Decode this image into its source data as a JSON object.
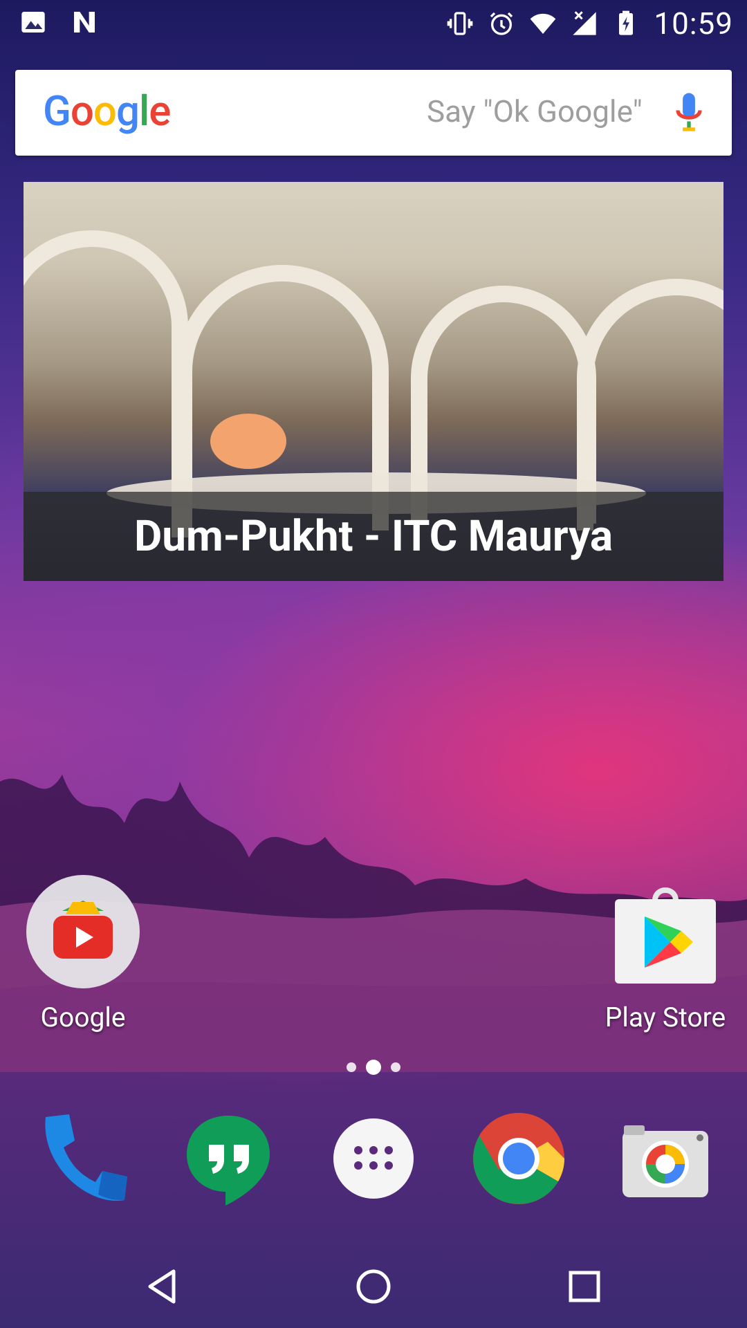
{
  "status_bar": {
    "time": "10:59",
    "left_icons": [
      "gallery-notification-icon",
      "n-notification-icon"
    ],
    "right_icons": [
      "vibrate-icon",
      "alarm-icon",
      "wifi-icon",
      "signal-icon",
      "battery-charging-icon"
    ]
  },
  "search_bar": {
    "logo_text": "Google",
    "hint": "Say \"Ok Google\"",
    "mic_icon": "microphone-icon"
  },
  "widget": {
    "caption": "Dum-Pukht - ITC Maurya"
  },
  "apps": [
    {
      "label": "Google",
      "icon": "google-folder-icon"
    },
    {
      "label": "Play Store",
      "icon": "play-store-icon"
    }
  ],
  "page_indicator": {
    "count": 3,
    "active_index": 1
  },
  "dock": [
    {
      "name": "phone",
      "icon": "phone-icon"
    },
    {
      "name": "hangouts",
      "icon": "hangouts-icon"
    },
    {
      "name": "app-drawer",
      "icon": "app-drawer-icon"
    },
    {
      "name": "chrome",
      "icon": "chrome-icon"
    },
    {
      "name": "camera",
      "icon": "camera-icon"
    }
  ],
  "nav_bar": [
    "back-icon",
    "home-icon",
    "recents-icon"
  ]
}
